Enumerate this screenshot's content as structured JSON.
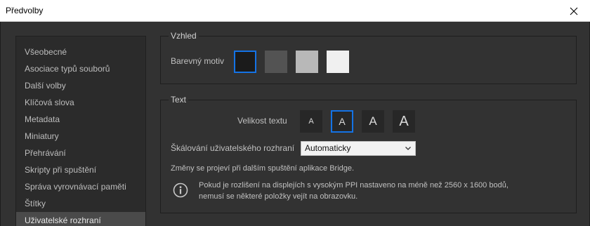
{
  "window": {
    "title": "Předvolby"
  },
  "sidebar": {
    "items": [
      {
        "label": "Všeobecné"
      },
      {
        "label": "Asociace typů souborů"
      },
      {
        "label": "Další volby"
      },
      {
        "label": "Klíčová slova"
      },
      {
        "label": "Metadata"
      },
      {
        "label": "Miniatury"
      },
      {
        "label": "Přehrávání"
      },
      {
        "label": "Skripty při spuštění"
      },
      {
        "label": "Správa vyrovnávací paměti"
      },
      {
        "label": "Štítky"
      },
      {
        "label": "Uživatelské rozhraní"
      }
    ],
    "selected_index": 10
  },
  "appearance": {
    "group_title": "Vzhled",
    "theme_label": "Barevný motiv",
    "themes": [
      {
        "color": "#1b1b1b",
        "selected": true
      },
      {
        "color": "#535353",
        "selected": false
      },
      {
        "color": "#b8b8b8",
        "selected": false
      },
      {
        "color": "#f0f0f0",
        "selected": false
      }
    ]
  },
  "text": {
    "group_title": "Text",
    "size_label": "Velikost textu",
    "size_options": [
      {
        "glyph": "A",
        "selected": false
      },
      {
        "glyph": "A",
        "selected": true
      },
      {
        "glyph": "A",
        "selected": false
      },
      {
        "glyph": "A",
        "selected": false
      }
    ],
    "scaling_label": "Škálování uživatelského rozhraní",
    "scaling_value": "Automaticky",
    "restart_note": "Změny se projeví při dalším spuštění aplikace Bridge.",
    "warning_line1": "Pokud je rozlišení na displejích s vysokým PPI nastaveno na méně než 2560 x 1600 bodů,",
    "warning_line2": "nemusí se některé položky vejít na obrazovku."
  },
  "colors": {
    "accent": "#1473e6",
    "panel": "#323232",
    "sidebar": "#2b2b2b",
    "selection": "#4a4a4a"
  },
  "icons": {
    "close": "close-icon",
    "dropdown": "chevron-down-icon",
    "info": "info-icon"
  }
}
